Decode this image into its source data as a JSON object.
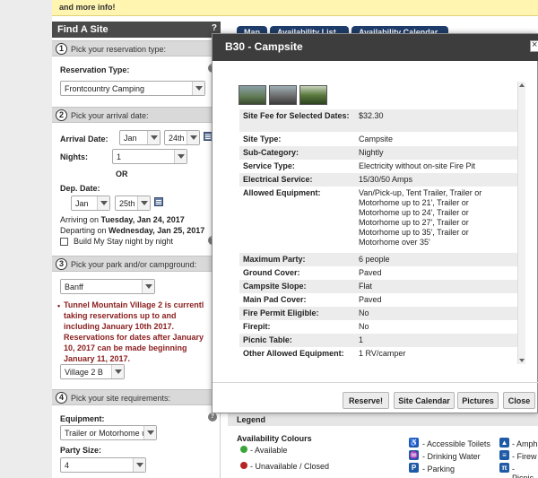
{
  "banner": {
    "text": "and more info!"
  },
  "panel": {
    "title": "Find A Site",
    "help": "?",
    "step1": {
      "num": "1",
      "label": "Pick your reservation type:"
    },
    "reservation_type_label": "Reservation Type:",
    "reservation_type_value": "Frontcountry Camping",
    "step2": {
      "num": "2",
      "label": "Pick your arrival date:"
    },
    "arrival_label": "Arrival Date:",
    "arrival_month": "Jan",
    "arrival_day": "24th",
    "nights_label": "Nights:",
    "nights_value": "1",
    "or_text": "OR",
    "dep_label": "Dep. Date:",
    "dep_month": "Jan",
    "dep_day": "25th",
    "arriving_prefix": "Arriving on ",
    "arriving_date": "Tuesday, Jan 24, 2017",
    "departing_prefix": "Departing on ",
    "departing_date": "Wednesday, Jan 25, 2017",
    "build_stay_label": "Build My Stay night by night",
    "step3": {
      "num": "3",
      "label": "Pick your park and/or campground:"
    },
    "park_value": "Banff",
    "warning_lines": [
      "Tunnel Mountain Village 2 is currentl",
      "taking reservations up to and",
      "including January 10th 2017.",
      "Reservations for dates after January",
      "10, 2017 can be made beginning",
      "January 11, 2017."
    ],
    "campground_value": "Village 2 B",
    "step4": {
      "num": "4",
      "label": "Pick your site requirements:"
    },
    "equipment_label": "Equipment:",
    "equipment_value": "Trailer or Motorhome u",
    "party_label": "Party Size:",
    "party_value": "4"
  },
  "tabs": [
    "Map",
    "Availability List",
    "Availability Calendar"
  ],
  "modal": {
    "title": "B30 - Campsite",
    "rows": [
      {
        "k": "Site Fee for Selected Dates:",
        "v": "$32.30"
      },
      {
        "k": "Site Type:",
        "v": "Campsite"
      },
      {
        "k": "Sub-Category:",
        "v": "Nightly"
      },
      {
        "k": "Service Type:",
        "v": "Electricity without on-site Fire Pit"
      },
      {
        "k": "Electrical Service:",
        "v": "15/30/50 Amps"
      },
      {
        "k": "Allowed Equipment:",
        "v": "Van/Pick-up, Tent Trailer, Trailer or Motorhome up to 21', Trailer or Motorhome up to 24', Trailer or Motorhome up to 27', Trailer or Motorhome up to 35', Trailer or Motorhome over 35'"
      },
      {
        "k": "Maximum Party:",
        "v": "6 people"
      },
      {
        "k": "Ground Cover:",
        "v": "Paved"
      },
      {
        "k": "Campsite Slope:",
        "v": "Flat"
      },
      {
        "k": "Main Pad Cover:",
        "v": "Paved"
      },
      {
        "k": "Fire Permit Eligible:",
        "v": "No"
      },
      {
        "k": "Firepit:",
        "v": "No"
      },
      {
        "k": "Picnic Table:",
        "v": "1"
      },
      {
        "k": "Other Allowed Equipment:",
        "v": "1 RV/camper"
      }
    ],
    "buttons": [
      "Reserve!",
      "Site Calendar",
      "Pictures",
      "Close"
    ]
  },
  "legend": {
    "title": "Legend",
    "availability_title": "Availability Colours",
    "available": "- Available",
    "unavailable": "- Unavailable / Closed",
    "available_color": "#3aa53a",
    "unavailable_color": "#b52525",
    "amenities": [
      "- Accessible Toilets",
      "- Drinking Water",
      "- Parking"
    ],
    "amenities_right": [
      "- Amph",
      "- Firew",
      "- Picnic"
    ]
  }
}
